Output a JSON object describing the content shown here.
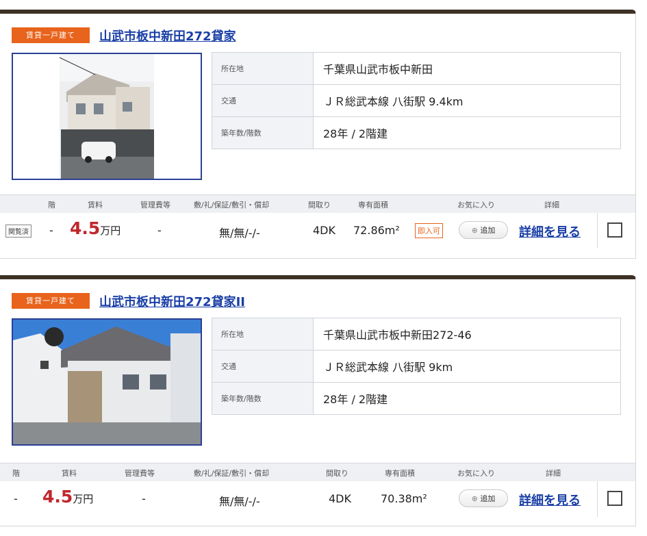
{
  "listings": [
    {
      "tag": "賃貸一戸建て",
      "title": "山武市板中新田272貸家",
      "info": [
        {
          "label": "所在地",
          "value": "千葉県山武市板中新田"
        },
        {
          "label": "交通",
          "value": "ＪＲ総武本線 八街駅 9.4km"
        },
        {
          "label": "築年数/階数",
          "value": "28年 / 2階建"
        }
      ],
      "headers": {
        "floor": "階",
        "rent": "賃料",
        "mgmt": "管理費等",
        "deposit": "敷/礼/保証/敷引・償却",
        "layout": "間取り",
        "area": "専有面積",
        "fav": "お気に入り",
        "detail": "詳細"
      },
      "row": {
        "badge": "関覧済",
        "floor": "-",
        "rent_num": "4.5",
        "rent_unit": "万円",
        "mgmt": "-",
        "deposit": "無/無/-/-",
        "layout": "4DK",
        "area": "72.86m²",
        "extra_badge": "即入可",
        "add_label": "追加",
        "detail_label": "詳細を見る"
      }
    },
    {
      "tag": "賃貸一戸建て",
      "title": "山武市板中新田272貸家II",
      "info": [
        {
          "label": "所在地",
          "value": "千葉県山武市板中新田272-46"
        },
        {
          "label": "交通",
          "value": "ＪＲ総武本線 八街駅 9km"
        },
        {
          "label": "築年数/階数",
          "value": "28年 / 2階建"
        }
      ],
      "headers": {
        "floor": "階",
        "rent": "賃料",
        "mgmt": "管理費等",
        "deposit": "敷/礼/保証/敷引・償却",
        "layout": "間取り",
        "area": "専有面積",
        "fav": "お気に入り",
        "detail": "詳細"
      },
      "row": {
        "floor": "-",
        "rent_num": "4.5",
        "rent_unit": "万円",
        "mgmt": "-",
        "deposit": "無/無/-/-",
        "layout": "4DK",
        "area": "70.38m²",
        "add_label": "追加",
        "detail_label": "詳細を見る"
      }
    }
  ],
  "colors": {
    "tag_bg": "#e8631c",
    "title_link": "#1a3fa6",
    "price": "#c0272d",
    "card_top": "#3d3226"
  }
}
